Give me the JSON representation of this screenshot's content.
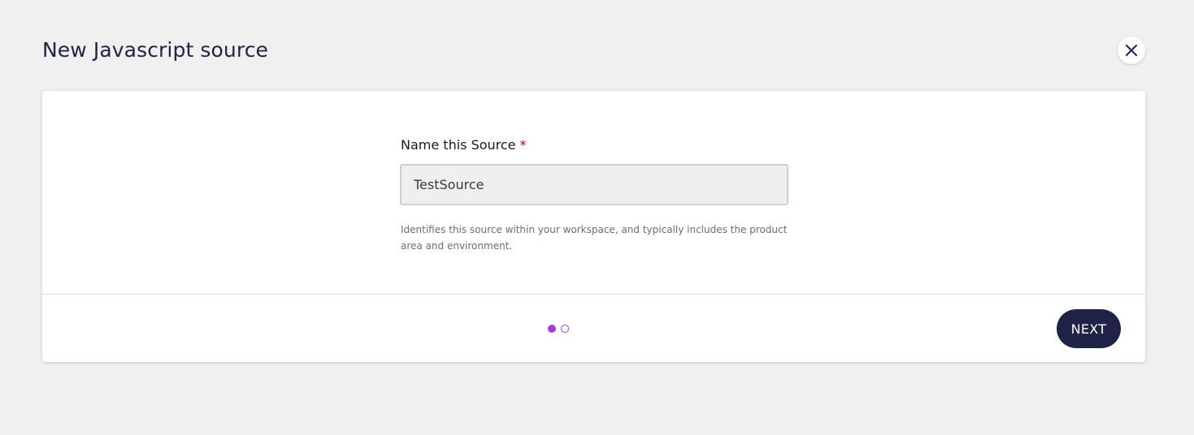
{
  "dialog": {
    "title": "New Javascript source",
    "close_icon": "close-icon"
  },
  "form": {
    "name_label": "Name this Source",
    "required_mark": "*",
    "name_value": "TestSource",
    "helper_text": "Identifies this source within your workspace, and typically includes the product area and environment."
  },
  "footer": {
    "steps_total": 2,
    "current_step": 1,
    "next_label": "NEXT"
  },
  "colors": {
    "background": "#f0f0f0",
    "title_text": "#1f2347",
    "primary_button": "#1f2347",
    "required": "#d0021b",
    "step_dot": "#a23fe0"
  }
}
